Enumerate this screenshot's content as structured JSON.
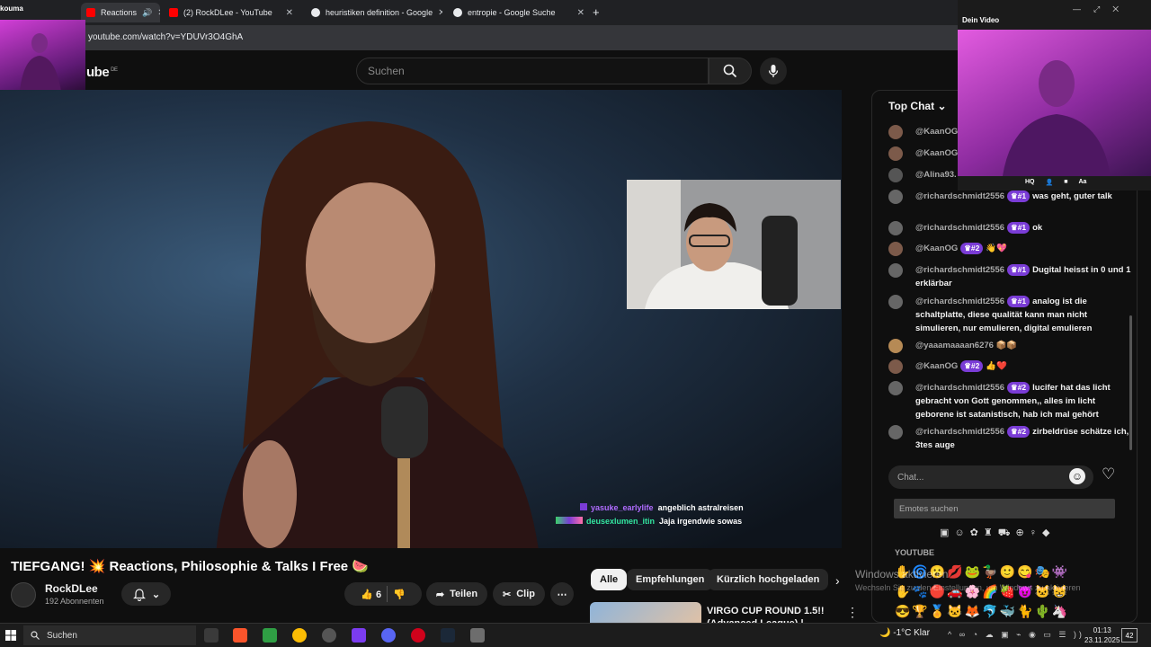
{
  "browser": {
    "tabs": [
      {
        "label": "Reactions",
        "active": true
      },
      {
        "label": "(2) RockDLee - YouTube",
        "active": false
      },
      {
        "label": "heuristiken definition - Google",
        "active": false
      },
      {
        "label": "entropie - Google Suche",
        "active": false
      }
    ],
    "url": "youtube.com/watch?v=YDUVr3O4GhA"
  },
  "overlay": {
    "my_cam_label": "kouma",
    "dein_video_label": "Dein Video",
    "cam_controls": [
      "HQ",
      "Aa"
    ]
  },
  "youtube": {
    "logo_text": "ube",
    "logo_region": "DE",
    "search_placeholder": "Suchen"
  },
  "video": {
    "overlay_chat": [
      {
        "user": "yasuke_earlylife",
        "text": "angeblich astralreisen",
        "user_color": "#b06cff"
      },
      {
        "user": "deusexlumen_itin",
        "text": "Jaja irgendwie sowas",
        "user_color": "#33e6a0"
      }
    ],
    "title": "TIEFGANG! 💥 Reactions, Philosophie & Talks I Free 🍉",
    "channel": "RockDLee",
    "subscribers": "192 Abonnenten",
    "likes": "6",
    "share_label": "Teilen",
    "clip_label": "Clip"
  },
  "recommendations": {
    "chips": [
      "Alle",
      "Empfehlungen",
      "Kürzlich hochgeladen"
    ],
    "first_title": "VIRGO CUP ROUND 1.5!! (Advanced League) |"
  },
  "chat": {
    "header": "Top Chat",
    "messages": [
      {
        "user": "@KaanOG",
        "badge": "",
        "text": ""
      },
      {
        "user": "@KaanOG",
        "badge": "",
        "text": ""
      },
      {
        "user": "@Alina93.",
        "badge": "",
        "text": ""
      },
      {
        "user": "@richardschmidt2556",
        "badge": "#1",
        "text": "was geht, guter talk"
      },
      {
        "user": "@richardschmidt2556",
        "badge": "#1",
        "text": "ok"
      },
      {
        "user": "@KaanOG",
        "badge": "#2",
        "text": ""
      },
      {
        "user": "@richardschmidt2556",
        "badge": "#1",
        "text": "Dugital heisst in 0 und 1 erklärbar"
      },
      {
        "user": "@richardschmidt2556",
        "badge": "#1",
        "text": "analog ist die schaltplatte, diese qualität kann man nicht simulieren, nur emulieren, digital emulieren"
      },
      {
        "user": "@yaaamaaaan6276",
        "badge": "",
        "text": ""
      },
      {
        "user": "@KaanOG",
        "badge": "#2",
        "text": ""
      },
      {
        "user": "@richardschmidt2556",
        "badge": "#2",
        "text": "lucifer hat das licht gebracht von Gott genommen,, alles im licht geborene ist satanistisch, hab ich mal gehört"
      },
      {
        "user": "@richardschmidt2556",
        "badge": "#2",
        "text": "zirbeldrüse schätze ich, 3tes auge"
      }
    ],
    "input_placeholder": "Chat...",
    "emote_search_placeholder": "Emotes suchen",
    "emote_section": "YOUTUBE"
  },
  "windows": {
    "watermark_title": "Windows aktivieren",
    "watermark_sub": "Wechseln Sie zu den Einstellungen, um Windows zu aktivieren.",
    "taskbar_search": "Suchen",
    "weather": "-1°C  Klar",
    "time": "01:13",
    "date": "23.11.2025",
    "notifications": "42"
  },
  "colors": {
    "accent_purple": "#7a3cd6",
    "yt_red": "#ff0000"
  }
}
